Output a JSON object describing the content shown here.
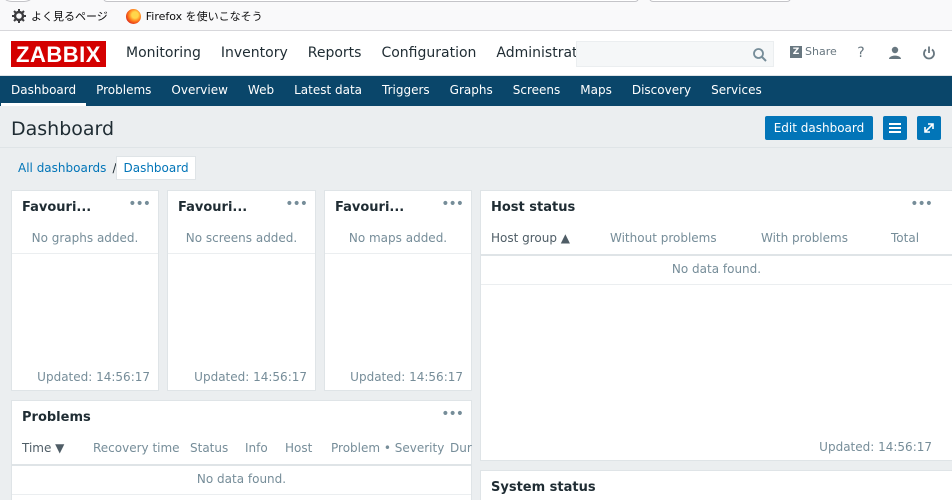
{
  "bookmarks": [
    {
      "label": "よく見るページ",
      "icon": "gear-icon"
    },
    {
      "label": "Firefox を使いこなそう",
      "icon": "firefox-icon"
    }
  ],
  "header": {
    "logo": "ZABBIX",
    "menu": [
      "Monitoring",
      "Inventory",
      "Reports",
      "Configuration",
      "Administration"
    ],
    "search_placeholder": "",
    "share_label": "Share",
    "help_label": "?"
  },
  "submenu": [
    "Dashboard",
    "Problems",
    "Overview",
    "Web",
    "Latest data",
    "Triggers",
    "Graphs",
    "Screens",
    "Maps",
    "Discovery",
    "Services"
  ],
  "page": {
    "title": "Dashboard",
    "edit_button": "Edit dashboard",
    "breadcrumb": [
      "All dashboards",
      "Dashboard"
    ]
  },
  "widgets": {
    "fav_graphs": {
      "title": "Favouri...",
      "message": "No graphs added.",
      "updated": "Updated: 14:56:17"
    },
    "fav_screens": {
      "title": "Favouri...",
      "message": "No screens added.",
      "updated": "Updated: 14:56:17"
    },
    "fav_maps": {
      "title": "Favouri...",
      "message": "No maps added.",
      "updated": "Updated: 14:56:17"
    },
    "host_status": {
      "title": "Host status",
      "columns": [
        "Host group ▲",
        "Without problems",
        "With problems",
        "Total"
      ],
      "message": "No data found.",
      "updated": "Updated: 14:56:17"
    },
    "problems": {
      "title": "Problems",
      "columns": [
        "Time ▼",
        "Recovery time",
        "Status",
        "Info",
        "Host",
        "Problem • Severity",
        "Dur"
      ],
      "message": "No data found."
    },
    "system_status": {
      "title": "System status"
    }
  },
  "colors": {
    "brand": "#d40000",
    "nav": "#0a466a",
    "accent": "#0275b8"
  }
}
